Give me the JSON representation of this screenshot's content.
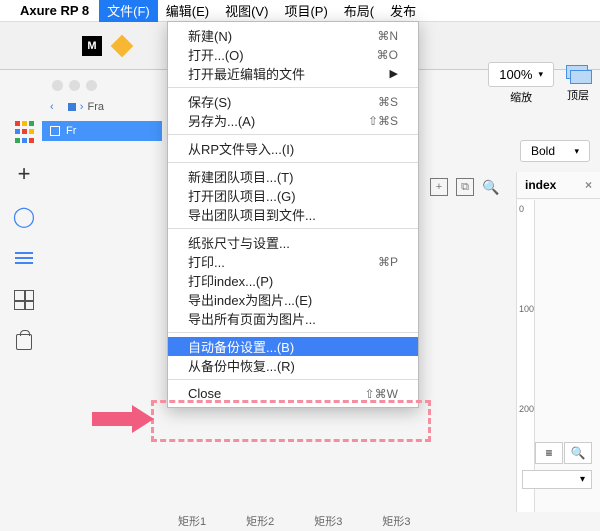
{
  "menubar": {
    "app_name": "Axure RP 8",
    "items": [
      "文件(F)",
      "编辑(E)",
      "视图(V)",
      "项目(P)",
      "布局(",
      "发布"
    ]
  },
  "zoom": {
    "value": "100%",
    "label": "缩放"
  },
  "layer": {
    "label": "顶层"
  },
  "font_weight": {
    "value": "Bold"
  },
  "breadcrumb": {
    "item": "Fra"
  },
  "frame": {
    "label": "Fr"
  },
  "dropdown": {
    "items": [
      {
        "label": "新建(N)",
        "shortcut": "⌘N"
      },
      {
        "label": "打开...(O)",
        "shortcut": "⌘O"
      },
      {
        "label": "打开最近编辑的文件",
        "submenu": true
      },
      {
        "sep": true
      },
      {
        "label": "保存(S)",
        "shortcut": "⌘S"
      },
      {
        "label": "另存为...(A)",
        "shortcut": "⇧⌘S"
      },
      {
        "sep": true
      },
      {
        "label": "从RP文件导入...(I)"
      },
      {
        "sep": true
      },
      {
        "label": "新建团队项目...(T)"
      },
      {
        "label": "打开团队项目...(G)"
      },
      {
        "label": "导出团队项目到文件..."
      },
      {
        "sep": true
      },
      {
        "label": "纸张尺寸与设置..."
      },
      {
        "label": "打印...",
        "shortcut": "⌘P"
      },
      {
        "label": "打印index...(P)"
      },
      {
        "label": "导出index为图片...(E)"
      },
      {
        "label": "导出所有页面为图片..."
      },
      {
        "sep": true
      },
      {
        "label": "自动备份设置...(B)",
        "highlighted": true
      },
      {
        "label": "从备份中恢复...(R)"
      },
      {
        "sep": true
      },
      {
        "label": "Close",
        "shortcut": "⇧⌘W"
      }
    ]
  },
  "index_panel": {
    "title": "index",
    "ticks": [
      "0",
      "100",
      "200"
    ]
  },
  "bottom": {
    "items": [
      "矩形1",
      "矩形2",
      "矩形3",
      "矩形3"
    ]
  }
}
